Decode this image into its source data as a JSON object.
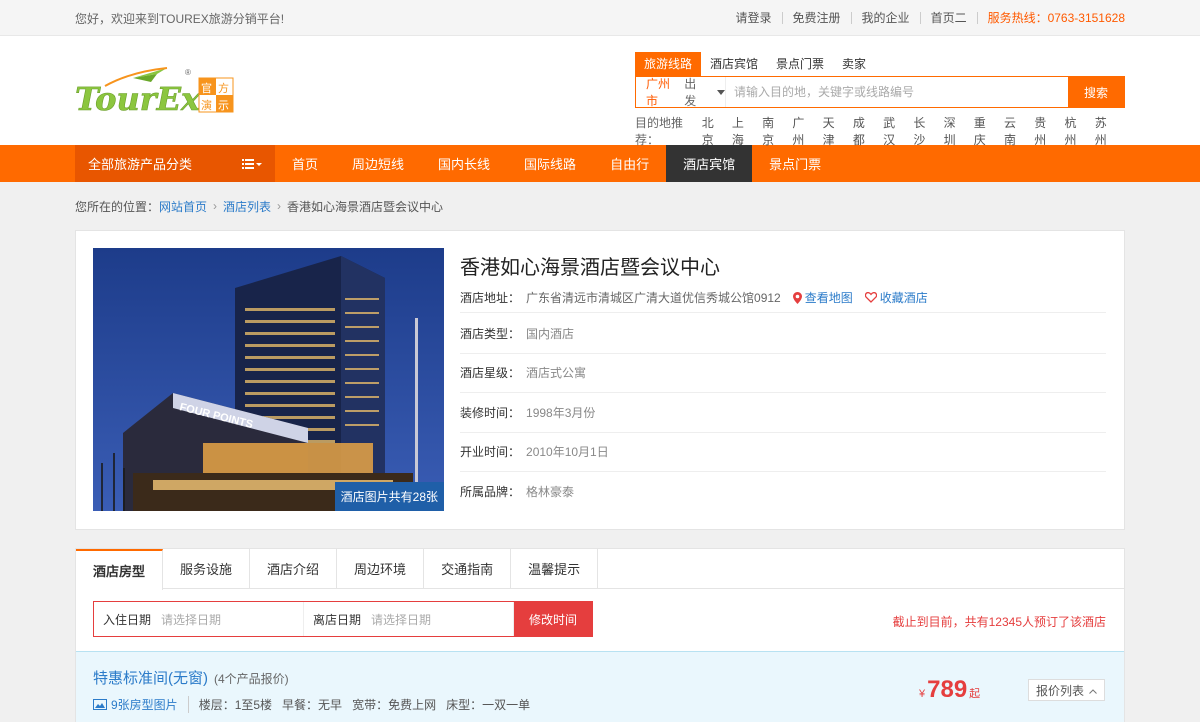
{
  "topbar": {
    "welcome": "您好，欢迎来到TOUREX旅游分销平台!",
    "links": [
      "请登录",
      "免费注册",
      "我的企业",
      "首页二"
    ],
    "hotline": "服务热线：0763-3151628"
  },
  "logo": {
    "text": "TourEx",
    "badge_line1": "官方",
    "badge_line2": "演示",
    "reg": "®"
  },
  "search": {
    "tabs": [
      "旅游线路",
      "酒店宾馆",
      "景点门票",
      "卖家"
    ],
    "city": "广州市",
    "depart": "出发",
    "placeholder": "请输入目的地，关键字或线路编号",
    "button": "搜索",
    "dest_label": "目的地推荐：",
    "dests": [
      "北京",
      "上海",
      "南京",
      "广州",
      "天津",
      "成都",
      "武汉",
      "长沙",
      "深圳",
      "重庆",
      "云南",
      "贵州",
      "杭州",
      "苏州"
    ]
  },
  "nav": {
    "all_categories": "全部旅游产品分类",
    "items": [
      "首页",
      "周边短线",
      "国内长线",
      "国际线路",
      "自由行",
      "酒店宾馆",
      "景点门票"
    ]
  },
  "breadcrumb": {
    "prefix": "您所在的位置：",
    "home": "网站首页",
    "list": "酒店列表",
    "current": "香港如心海景酒店暨会议中心"
  },
  "hotel": {
    "name": "香港如心海景酒店暨会议中心",
    "address_label": "酒店地址：",
    "address": "广东省清远市清城区广清大道优信秀城公馆0912",
    "map_link": "查看地图",
    "fav_link": "收藏酒店",
    "photo_count": "酒店图片共有28张",
    "sign_text": "FOUR POINTS",
    "rows": [
      {
        "label": "酒店类型：",
        "value": "国内酒店"
      },
      {
        "label": "酒店星级：",
        "value": "酒店式公寓"
      },
      {
        "label": "装修时间：",
        "value": "1998年3月份"
      },
      {
        "label": "开业时间：",
        "value": "2010年10月1日"
      },
      {
        "label": "所属品牌：",
        "value": "格林豪泰"
      }
    ]
  },
  "tabs": [
    "酒店房型",
    "服务设施",
    "酒店介绍",
    "周边环境",
    "交通指南",
    "温馨提示"
  ],
  "booking": {
    "checkin_label": "入住日期",
    "checkin_placeholder": "请选择日期",
    "checkout_label": "离店日期",
    "checkout_placeholder": "请选择日期",
    "button": "修改时间",
    "booked_text": "截止到目前，共有12345人预订了该酒店"
  },
  "room": {
    "name": "特惠标准间(无窗)",
    "offers": "(4个产品报价)",
    "pics": "9张房型图片",
    "meta": [
      "楼层：1至5楼",
      "早餐：无早",
      "宽带：免费上网",
      "床型：一双一单"
    ],
    "yen": "¥",
    "price": "789",
    "qi": "起",
    "price_list": "报价列表"
  },
  "colors": {
    "accent": "#ff6a00",
    "link": "#2b7bc9",
    "red": "#e53e3e",
    "nav_active": "#333333"
  }
}
